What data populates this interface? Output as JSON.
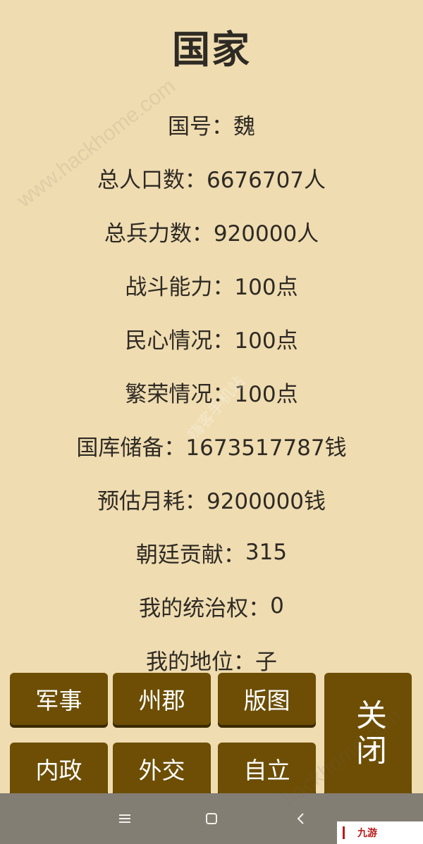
{
  "header": {
    "title": "国家"
  },
  "stats": [
    {
      "label": "国号：",
      "value": "魏"
    },
    {
      "label": "总人口数：",
      "value": "6676707人"
    },
    {
      "label": "总兵力数：",
      "value": "920000人"
    },
    {
      "label": "战斗能力：",
      "value": "100点"
    },
    {
      "label": "民心情况：",
      "value": "100点"
    },
    {
      "label": "繁荣情况：",
      "value": "100点"
    },
    {
      "label": "国库储备：",
      "value": "1673517787钱"
    },
    {
      "label": "预估月耗：",
      "value": "9200000钱"
    },
    {
      "label": "朝廷贡献：",
      "value": "315"
    },
    {
      "label": "我的统治权：",
      "value": "0"
    },
    {
      "label": "我的地位：",
      "value": "子"
    }
  ],
  "buttons": {
    "military": "军事",
    "provinces": "州郡",
    "territory": "版图",
    "internal_affairs": "内政",
    "diplomacy": "外交",
    "independence": "自立",
    "close": "关闭"
  },
  "watermarks": {
    "site": "www.hackhome.com",
    "site_repeat": "hackhome.com",
    "cn": "嗨客手机站"
  },
  "corner_logo": {
    "text": "九游"
  },
  "navbar": {
    "icons": [
      "menu-icon",
      "home-icon",
      "back-icon"
    ]
  },
  "colors": {
    "background": "#efdcb1",
    "button": "#6d4e04",
    "button_text": "#ffffff",
    "navbar": "#837e74"
  }
}
